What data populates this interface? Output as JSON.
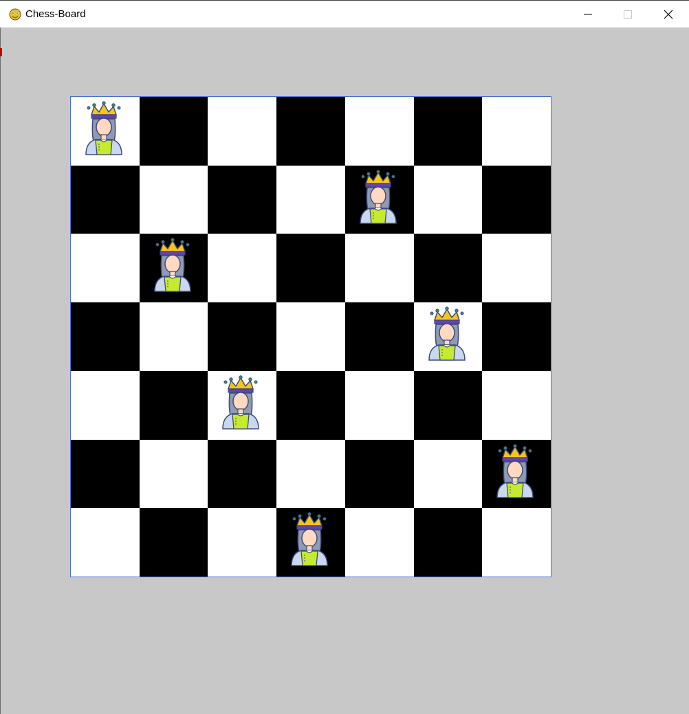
{
  "window": {
    "title": "Chess-Board",
    "icon": "pygame-snake-icon",
    "controls": [
      "minimize-icon",
      "maximize-icon",
      "close-icon"
    ]
  },
  "board": {
    "size": 7,
    "colors": {
      "light": "#ffffff",
      "dark": "#000000",
      "border": "#4a6fd1",
      "background": "#c8c8c8"
    },
    "queen_icon": "queen-icon",
    "queens": [
      {
        "row": 0,
        "col": 0
      },
      {
        "row": 1,
        "col": 4
      },
      {
        "row": 2,
        "col": 1
      },
      {
        "row": 3,
        "col": 5
      },
      {
        "row": 4,
        "col": 2
      },
      {
        "row": 5,
        "col": 6
      },
      {
        "row": 6,
        "col": 3
      }
    ]
  }
}
